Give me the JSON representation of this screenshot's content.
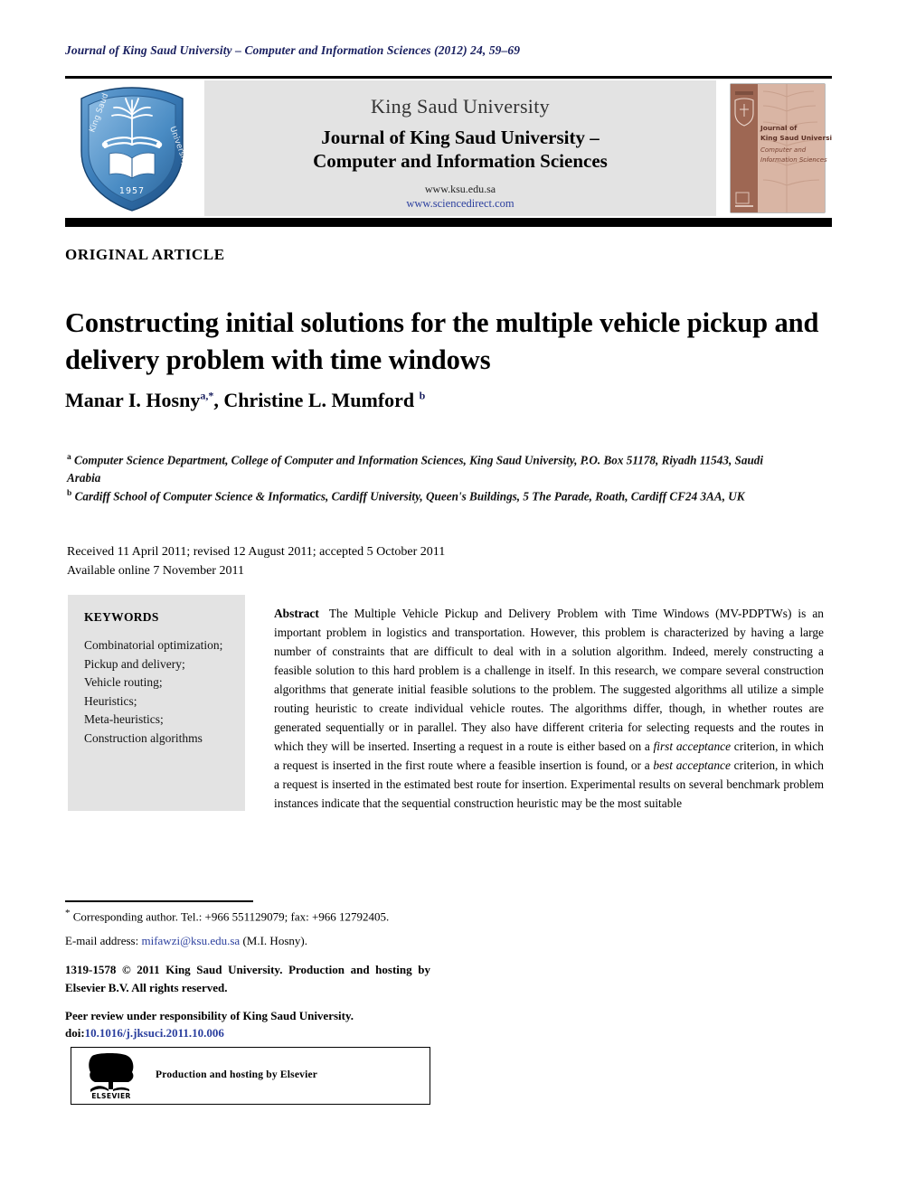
{
  "running_head": "Journal of King Saud University – Computer and Information Sciences (2012) 24, 59–69",
  "masthead": {
    "logo_alt": "king-saud-university-shield-logo",
    "logo_text_outer": "King Saud University",
    "logo_text_year": "1957",
    "banner": {
      "line1": "King Saud University",
      "line2a": "Journal of King Saud University –",
      "line2b": "Computer and Information Sciences",
      "url_university": "www.ksu.edu.sa",
      "url_sciencedirect": "www.sciencedirect.com"
    },
    "cover": {
      "line1": "Journal of",
      "line2": "King Saud University –",
      "line3": "Computer and",
      "line4": "Information Sciences"
    }
  },
  "article_type": "ORIGINAL ARTICLE",
  "title": "Constructing initial solutions for the multiple vehicle pickup and delivery problem with time windows",
  "authors": [
    {
      "name": "Manar I. Hosny",
      "marks": "a,*"
    },
    {
      "name": "Christine L. Mumford",
      "marks": "b"
    }
  ],
  "authors_separator": ", ",
  "affiliations": [
    {
      "mark": "a",
      "text": "Computer Science Department, College of Computer and Information Sciences, King Saud University, P.O. Box 51178, Riyadh 11543, Saudi Arabia"
    },
    {
      "mark": "b",
      "text": "Cardiff School of Computer Science & Informatics, Cardiff University, Queen's Buildings, 5 The Parade, Roath, Cardiff CF24 3AA, UK"
    }
  ],
  "history": {
    "line1": "Received 11 April 2011; revised 12 August 2011; accepted 5 October 2011",
    "line2": "Available online 7 November 2011"
  },
  "keywords": {
    "heading": "KEYWORDS",
    "items": [
      "Combinatorial optimization;",
      "Pickup and delivery;",
      "Vehicle routing;",
      "Heuristics;",
      "Meta-heuristics;",
      "Construction algorithms"
    ]
  },
  "abstract": {
    "label": "Abstract",
    "part1": "The Multiple Vehicle Pickup and Delivery Problem with Time Windows (MV-PDPTWs) is an important problem in logistics and transportation. However, this problem is characterized by having a large number of constraints that are difficult to deal with in a solution algorithm. Indeed, merely constructing a feasible solution to this hard problem is a challenge in itself. In this research, we compare several construction algorithms that generate initial feasible solutions to the problem. The suggested algorithms all utilize a simple routing heuristic to create individual vehicle routes. The algorithms differ, though, in whether routes are generated sequentially or in parallel. They also have different criteria for selecting requests and the routes in which they will be inserted. Inserting a request in a route is either based on a ",
    "emph1": "first acceptance",
    "part2": " criterion, in which a request is inserted in the first route where a feasible insertion is found, or a ",
    "emph2": "best acceptance",
    "part3": " criterion, in which a request is inserted in the estimated best route for insertion. Experimental results on several benchmark problem instances indicate that the sequential construction heuristic may be the most suitable"
  },
  "footnotes": {
    "corresponding_mark": "*",
    "corresponding": "Corresponding author. Tel.: +966 551129079; fax: +966 12792405.",
    "email_label": "E-mail address:",
    "email": "mifawzi@ksu.edu.sa",
    "email_owner": "(M.I. Hosny).",
    "issn_copyright": "1319-1578 © 2011 King Saud University. Production and hosting by Elsevier B.V. All rights reserved.",
    "peer_review": "Peer review under responsibility of King Saud University.",
    "doi_label": "doi:",
    "doi": "10.1016/j.jksuci.2011.10.006"
  },
  "elsevier_box": {
    "caption": "Production and hosting by Elsevier",
    "wordmark": "ELSEVIER"
  },
  "colors": {
    "link": "#2b3f9e",
    "running_head": "#1a2060",
    "panel_bg": "#e3e3e3",
    "logo_blue": "#2d6ca8",
    "cover_brown": "#9e6753"
  }
}
